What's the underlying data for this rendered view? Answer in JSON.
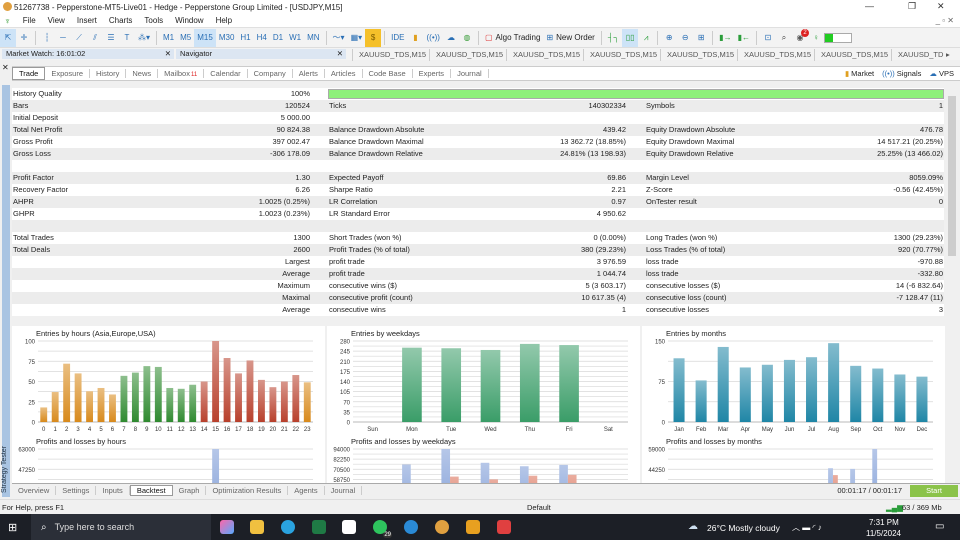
{
  "window": {
    "title": "51267738 - Pepperstone-MT5-Live01 - Hedge - Pepperstone Group Limited - [USDJPY,M15]"
  },
  "menu": [
    "File",
    "View",
    "Insert",
    "Charts",
    "Tools",
    "Window",
    "Help"
  ],
  "toolbar": {
    "timeframes": [
      "M1",
      "M5",
      "M15",
      "M30",
      "H1",
      "H4",
      "D1",
      "W1",
      "MN"
    ],
    "active_timeframe": "M15",
    "ide": "IDE",
    "algo_trading": "Algo Trading",
    "new_order": "New Order",
    "notifications_badge": "2"
  },
  "panels": {
    "market_watch": "Market Watch: 16:01:02",
    "navigator": "Navigator",
    "symbol_tabs": [
      "XAUUSD_TDS,M15",
      "XAUUSD_TDS,M15",
      "XAUUSD_TDS,M15",
      "XAUUSD_TDS,M15",
      "XAUUSD_TDS,M15",
      "XAUUSD_TDS,M15",
      "XAUUSD_TDS,M15",
      "XAUUSD_TD"
    ]
  },
  "toolbox_tabs": {
    "items": [
      "Trade",
      "Exposure",
      "History",
      "News",
      "Mailbox",
      "Calendar",
      "Company",
      "Alerts",
      "Articles",
      "Code Base",
      "Experts",
      "Journal"
    ],
    "active": "Trade",
    "mailbox_badge": "11",
    "market": "Market",
    "signals": "Signals",
    "vps": "VPS"
  },
  "stats": {
    "history_quality": 100,
    "rows": [
      [
        "History Quality",
        "100%",
        "",
        "",
        "",
        ""
      ],
      [
        "Bars",
        "120524",
        "Ticks",
        "140302334",
        "Symbols",
        "1"
      ],
      [
        "Initial Deposit",
        "5 000.00",
        "",
        "",
        "",
        ""
      ],
      [
        "Total Net Profit",
        "90 824.38",
        "Balance Drawdown Absolute",
        "439.42",
        "Equity Drawdown Absolute",
        "476.78"
      ],
      [
        "Gross Profit",
        "397 002.47",
        "Balance Drawdown Maximal",
        "13 362.72 (18.85%)",
        "Equity Drawdown Maximal",
        "14 517.21 (20.25%)"
      ],
      [
        "Gross Loss",
        "-306 178.09",
        "Balance Drawdown Relative",
        "24.81% (13 198.93)",
        "Equity Drawdown Relative",
        "25.25% (13 466.02)"
      ],
      [
        "",
        "",
        "",
        "",
        "",
        ""
      ],
      [
        "Profit Factor",
        "1.30",
        "Expected Payoff",
        "69.86",
        "Margin Level",
        "8059.09%"
      ],
      [
        "Recovery Factor",
        "6.26",
        "Sharpe Ratio",
        "2.21",
        "Z-Score",
        "-0.56 (42.45%)"
      ],
      [
        "AHPR",
        "1.0025 (0.25%)",
        "LR Correlation",
        "0.97",
        "OnTester result",
        "0"
      ],
      [
        "GHPR",
        "1.0023 (0.23%)",
        "LR Standard Error",
        "4 950.62",
        "",
        ""
      ],
      [
        "",
        "",
        "",
        "",
        "",
        ""
      ],
      [
        "Total Trades",
        "1300",
        "Short Trades (won %)",
        "0 (0.00%)",
        "Long Trades (won %)",
        "1300 (29.23%)"
      ],
      [
        "Total Deals",
        "2600",
        "Profit Trades (% of total)",
        "380 (29.23%)",
        "Loss Trades (% of total)",
        "920 (70.77%)"
      ],
      [
        "",
        "Largest",
        "profit trade",
        "3 976.59",
        "loss trade",
        "-970.88"
      ],
      [
        "",
        "Average",
        "profit trade",
        "1 044.74",
        "loss trade",
        "-332.80"
      ],
      [
        "",
        "Maximum",
        "consecutive wins ($)",
        "5 (3 603.17)",
        "consecutive losses ($)",
        "14 (-6 832.64)"
      ],
      [
        "",
        "Maximal",
        "consecutive profit (count)",
        "10 617.35 (4)",
        "consecutive loss (count)",
        "-7 128.47 (11)"
      ],
      [
        "",
        "Average",
        "consecutive wins",
        "1",
        "consecutive losses",
        "3"
      ]
    ]
  },
  "chart_data": [
    {
      "type": "bar",
      "title": "Entries by hours (Asia,Europe,USA)",
      "categories": [
        "0",
        "1",
        "2",
        "3",
        "4",
        "5",
        "6",
        "7",
        "8",
        "9",
        "10",
        "11",
        "12",
        "13",
        "14",
        "15",
        "16",
        "17",
        "18",
        "19",
        "20",
        "21",
        "22",
        "23"
      ],
      "values": [
        18,
        37,
        72,
        60,
        38,
        42,
        34,
        57,
        61,
        69,
        68,
        42,
        41,
        46,
        50,
        100,
        79,
        60,
        76,
        52,
        43,
        50,
        58,
        49
      ],
      "colors": [
        "#d88a1c",
        "#d88a1c",
        "#d88a1c",
        "#d88a1c",
        "#d88a1c",
        "#d88a1c",
        "#d88a1c",
        "#2f8a30",
        "#2f8a30",
        "#2f8a30",
        "#2f8a30",
        "#2f8a30",
        "#2f8a30",
        "#2f8a30",
        "#b8402c",
        "#b8402c",
        "#b8402c",
        "#b8402c",
        "#b8402c",
        "#b8402c",
        "#b8402c",
        "#b8402c",
        "#b8402c",
        "#d88a1c"
      ],
      "yticks": [
        0,
        25,
        50,
        75,
        100
      ],
      "ylim": [
        0,
        100
      ],
      "grid": true
    },
    {
      "type": "bar",
      "title": "Entries by weekdays",
      "categories": [
        "Sun",
        "Mon",
        "Tue",
        "Wed",
        "Thu",
        "Fri",
        "Sat"
      ],
      "values": [
        0,
        257,
        255,
        249,
        270,
        266,
        0
      ],
      "color": "#3a9d68",
      "yticks": [
        0,
        35,
        70,
        105,
        140,
        175,
        210,
        245,
        280
      ],
      "ylim": [
        0,
        280
      ],
      "grid": true
    },
    {
      "type": "bar",
      "title": "Entries by months",
      "categories": [
        "Jan",
        "Feb",
        "Mar",
        "Apr",
        "May",
        "Jun",
        "Jul",
        "Aug",
        "Sep",
        "Oct",
        "Nov",
        "Dec"
      ],
      "values": [
        118,
        77,
        139,
        101,
        106,
        115,
        120,
        146,
        104,
        99,
        88,
        84
      ],
      "color": "#1f86a6",
      "yticks": [
        0,
        75,
        150
      ],
      "ylim": [
        0,
        150
      ],
      "grid": true
    },
    {
      "type": "bar",
      "title": "Profits and losses by hours",
      "categories": [
        "0",
        "1",
        "2",
        "3",
        "4",
        "5",
        "6",
        "7",
        "8",
        "9",
        "10",
        "11",
        "12",
        "13",
        "14",
        "15",
        "16",
        "17",
        "18",
        "19",
        "20",
        "21",
        "22",
        "23"
      ],
      "series": [
        {
          "values": [
            null,
            null,
            null,
            null,
            null,
            null,
            null,
            null,
            null,
            null,
            null,
            null,
            null,
            null,
            null,
            63000,
            null,
            null,
            null,
            null,
            null,
            null,
            null,
            null
          ],
          "color": "#7b9ad6"
        }
      ],
      "yticks": [
        47250,
        63000
      ],
      "ylim": [
        0,
        63000
      ],
      "grid": true
    },
    {
      "type": "bar",
      "title": "Profits and losses by weekdays",
      "categories": [
        "Sun",
        "Mon",
        "Tue",
        "Wed",
        "Thu",
        "Fri",
        "Sat"
      ],
      "series": [
        {
          "values": [
            null,
            76000,
            94000,
            78000,
            74000,
            75500,
            null
          ],
          "color": "#7b9ad6"
        },
        {
          "values": [
            null,
            null,
            62000,
            58750,
            63000,
            64000,
            null
          ],
          "color": "#d86a50"
        }
      ],
      "yticks": [
        58750,
        70500,
        82250,
        94000
      ],
      "ylim": [
        0,
        94000
      ],
      "grid": true
    },
    {
      "type": "bar",
      "title": "Profits and losses by months",
      "categories": [
        "Jan",
        "Feb",
        "Mar",
        "Apr",
        "May",
        "Jun",
        "Jul",
        "Aug",
        "Sep",
        "Oct",
        "Nov",
        "Dec"
      ],
      "series": [
        {
          "values": [
            null,
            null,
            null,
            null,
            null,
            null,
            null,
            45000,
            44500,
            59000,
            null,
            null
          ],
          "color": "#7b9ad6"
        },
        {
          "values": [
            null,
            null,
            null,
            null,
            null,
            null,
            32000,
            40000,
            null,
            null,
            null,
            null
          ],
          "color": "#d86a50"
        }
      ],
      "yticks": [
        44250,
        59000
      ],
      "ylim": [
        0,
        59000
      ],
      "grid": true
    }
  ],
  "tester_tabs": {
    "items": [
      "Overview",
      "Settings",
      "Inputs",
      "Backtest",
      "Graph",
      "Optimization Results",
      "Agents",
      "Journal"
    ],
    "active": "Backtest",
    "elapsed": "00:01:17 / 00:01:17",
    "start": "Start",
    "side_label": "Strategy Tester"
  },
  "statusbar": {
    "help": "For Help, press F1",
    "profile": "Default",
    "memory": "63 / 369 Mb"
  },
  "taskbar": {
    "search_placeholder": "Type here to search",
    "whatsapp_badge": "29",
    "weather": "26°C  Mostly cloudy",
    "time": "7:31 PM",
    "date": "11/5/2024"
  }
}
